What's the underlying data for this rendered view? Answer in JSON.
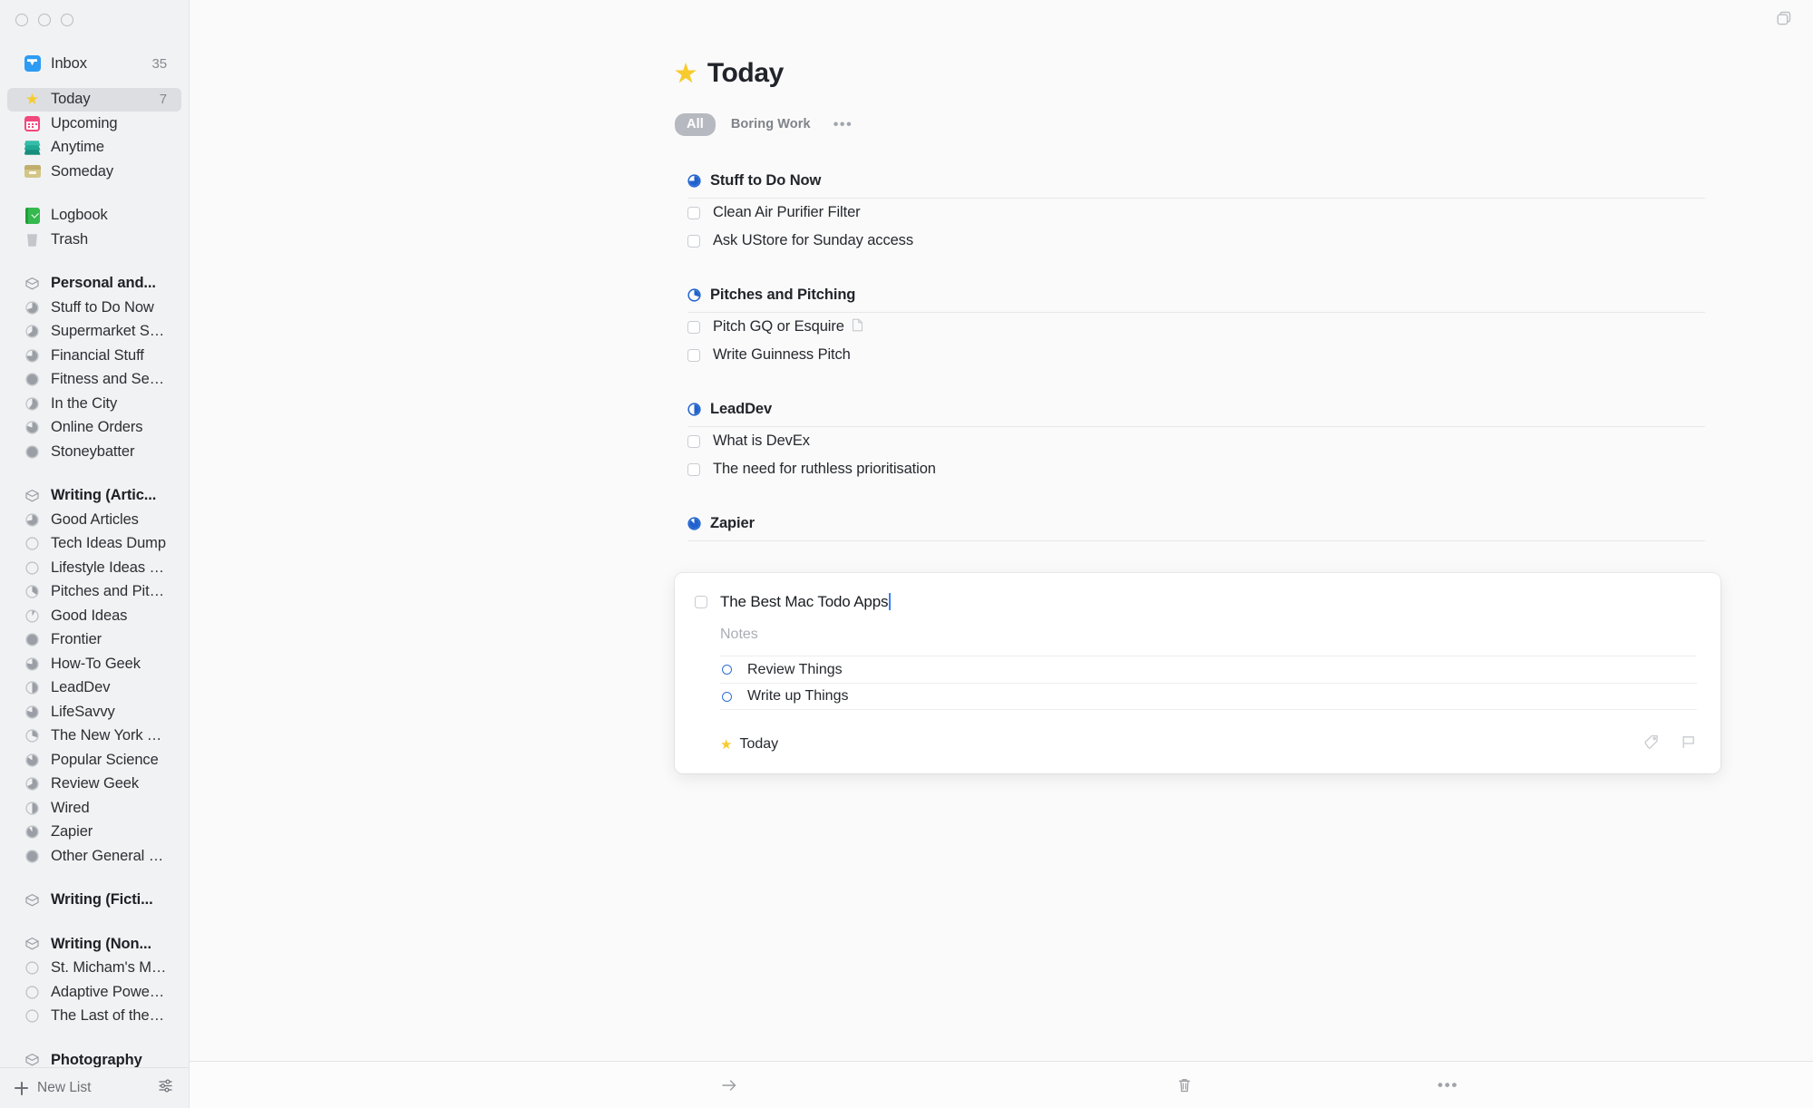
{
  "window": {
    "traffic_lights": [
      "close",
      "minimize",
      "zoom"
    ],
    "top_right_icon": "window-duplicate-icon"
  },
  "sidebar": {
    "top_items": [
      {
        "label": "Inbox",
        "icon": "inbox-icon",
        "count": "35",
        "selected": false
      },
      {
        "label": "Today",
        "icon": "star-icon",
        "count": "7",
        "selected": true
      },
      {
        "label": "Upcoming",
        "icon": "calendar-icon",
        "count": "",
        "selected": false
      },
      {
        "label": "Anytime",
        "icon": "layers-icon",
        "count": "",
        "selected": false
      },
      {
        "label": "Someday",
        "icon": "box-icon",
        "count": "",
        "selected": false
      }
    ],
    "second_items": [
      {
        "label": "Logbook",
        "icon": "logbook-icon",
        "count": "",
        "selected": false
      },
      {
        "label": "Trash",
        "icon": "trash-icon",
        "count": "",
        "selected": false
      }
    ],
    "areas": [
      {
        "label": "Personal and...",
        "icon": "area-icon",
        "projects": [
          {
            "label": "Stuff to Do Now",
            "progress": 70
          },
          {
            "label": "Supermarket Sho...",
            "progress": 65
          },
          {
            "label": "Financial Stuff",
            "progress": 75
          },
          {
            "label": "Fitness and Self I...",
            "progress": 100
          },
          {
            "label": "In the City",
            "progress": 60
          },
          {
            "label": "Online Orders",
            "progress": 80
          },
          {
            "label": "Stoneybatter",
            "progress": 100
          }
        ]
      },
      {
        "label": "Writing (Artic...",
        "icon": "area-icon",
        "projects": [
          {
            "label": "Good Articles",
            "progress": 72
          },
          {
            "label": "Tech Ideas Dump",
            "progress": 0
          },
          {
            "label": "Lifestyle Ideas Du...",
            "progress": 0
          },
          {
            "label": "Pitches and Pitch...",
            "progress": 35
          },
          {
            "label": "Good Ideas",
            "progress": 8
          },
          {
            "label": "Frontier",
            "progress": 100
          },
          {
            "label": "How-To Geek",
            "progress": 78
          },
          {
            "label": "LeadDev",
            "progress": 50
          },
          {
            "label": "LifeSavvy",
            "progress": 80
          },
          {
            "label": "The New York Ti...",
            "progress": 30
          },
          {
            "label": "Popular Science",
            "progress": 85
          },
          {
            "label": "Review Geek",
            "progress": 68
          },
          {
            "label": "Wired",
            "progress": 50
          },
          {
            "label": "Zapier",
            "progress": 90
          },
          {
            "label": "Other General Wr...",
            "progress": 100
          }
        ]
      },
      {
        "label": "Writing (Ficti...",
        "icon": "area-icon",
        "projects": []
      },
      {
        "label": "Writing (Non...",
        "icon": "area-icon",
        "projects": [
          {
            "label": "St. Micham's Mu...",
            "progress": 0
          },
          {
            "label": "Adaptive Powerlif...",
            "progress": 0
          },
          {
            "label": "The Last of the S...",
            "progress": 0
          }
        ]
      },
      {
        "label": "Photography",
        "icon": "area-icon",
        "projects": []
      }
    ],
    "footer": {
      "new_list_label": "New List",
      "new_list_icon": "plus-icon",
      "settings_icon": "sliders-icon"
    }
  },
  "main": {
    "title": "Today",
    "title_icon": "star-icon",
    "filters": {
      "active": "All",
      "others": [
        "Boring Work"
      ],
      "more_icon": "ellipsis-icon"
    },
    "groups": [
      {
        "name": "Stuff to Do Now",
        "progress": 75,
        "tasks": [
          {
            "label": "Clean Air Purifier Filter",
            "has_note": false
          },
          {
            "label": "Ask UStore for Sunday access",
            "has_note": false
          }
        ]
      },
      {
        "name": "Pitches and Pitching",
        "progress": 30,
        "tasks": [
          {
            "label": "Pitch GQ or Esquire",
            "has_note": true
          },
          {
            "label": "Write Guinness Pitch",
            "has_note": false
          }
        ]
      },
      {
        "name": "LeadDev",
        "progress": 50,
        "tasks": [
          {
            "label": "What is DevEx",
            "has_note": false
          },
          {
            "label": "The need for ruthless prioritisation",
            "has_note": false
          }
        ]
      },
      {
        "name": "Zapier",
        "progress": 88,
        "tasks": []
      }
    ],
    "open_card": {
      "title": "The Best Mac Todo Apps",
      "notes_placeholder": "Notes",
      "checklist": [
        {
          "label": "Review Things"
        },
        {
          "label": "Write up Things"
        }
      ],
      "when_label": "Today",
      "when_icon": "star-icon",
      "tag_icon": "tag-icon",
      "flag_icon": "flag-icon"
    }
  },
  "bottom_bar": {
    "move_icon": "arrow-right-icon",
    "delete_icon": "trash-icon",
    "more_icon": "ellipsis-icon"
  },
  "colors": {
    "accent_blue": "#2e6fd8",
    "star_yellow": "#f7cb2e",
    "sidebar_bg": "#f1f2f4",
    "main_bg": "#fafafa",
    "selection": "#dcdee2"
  }
}
